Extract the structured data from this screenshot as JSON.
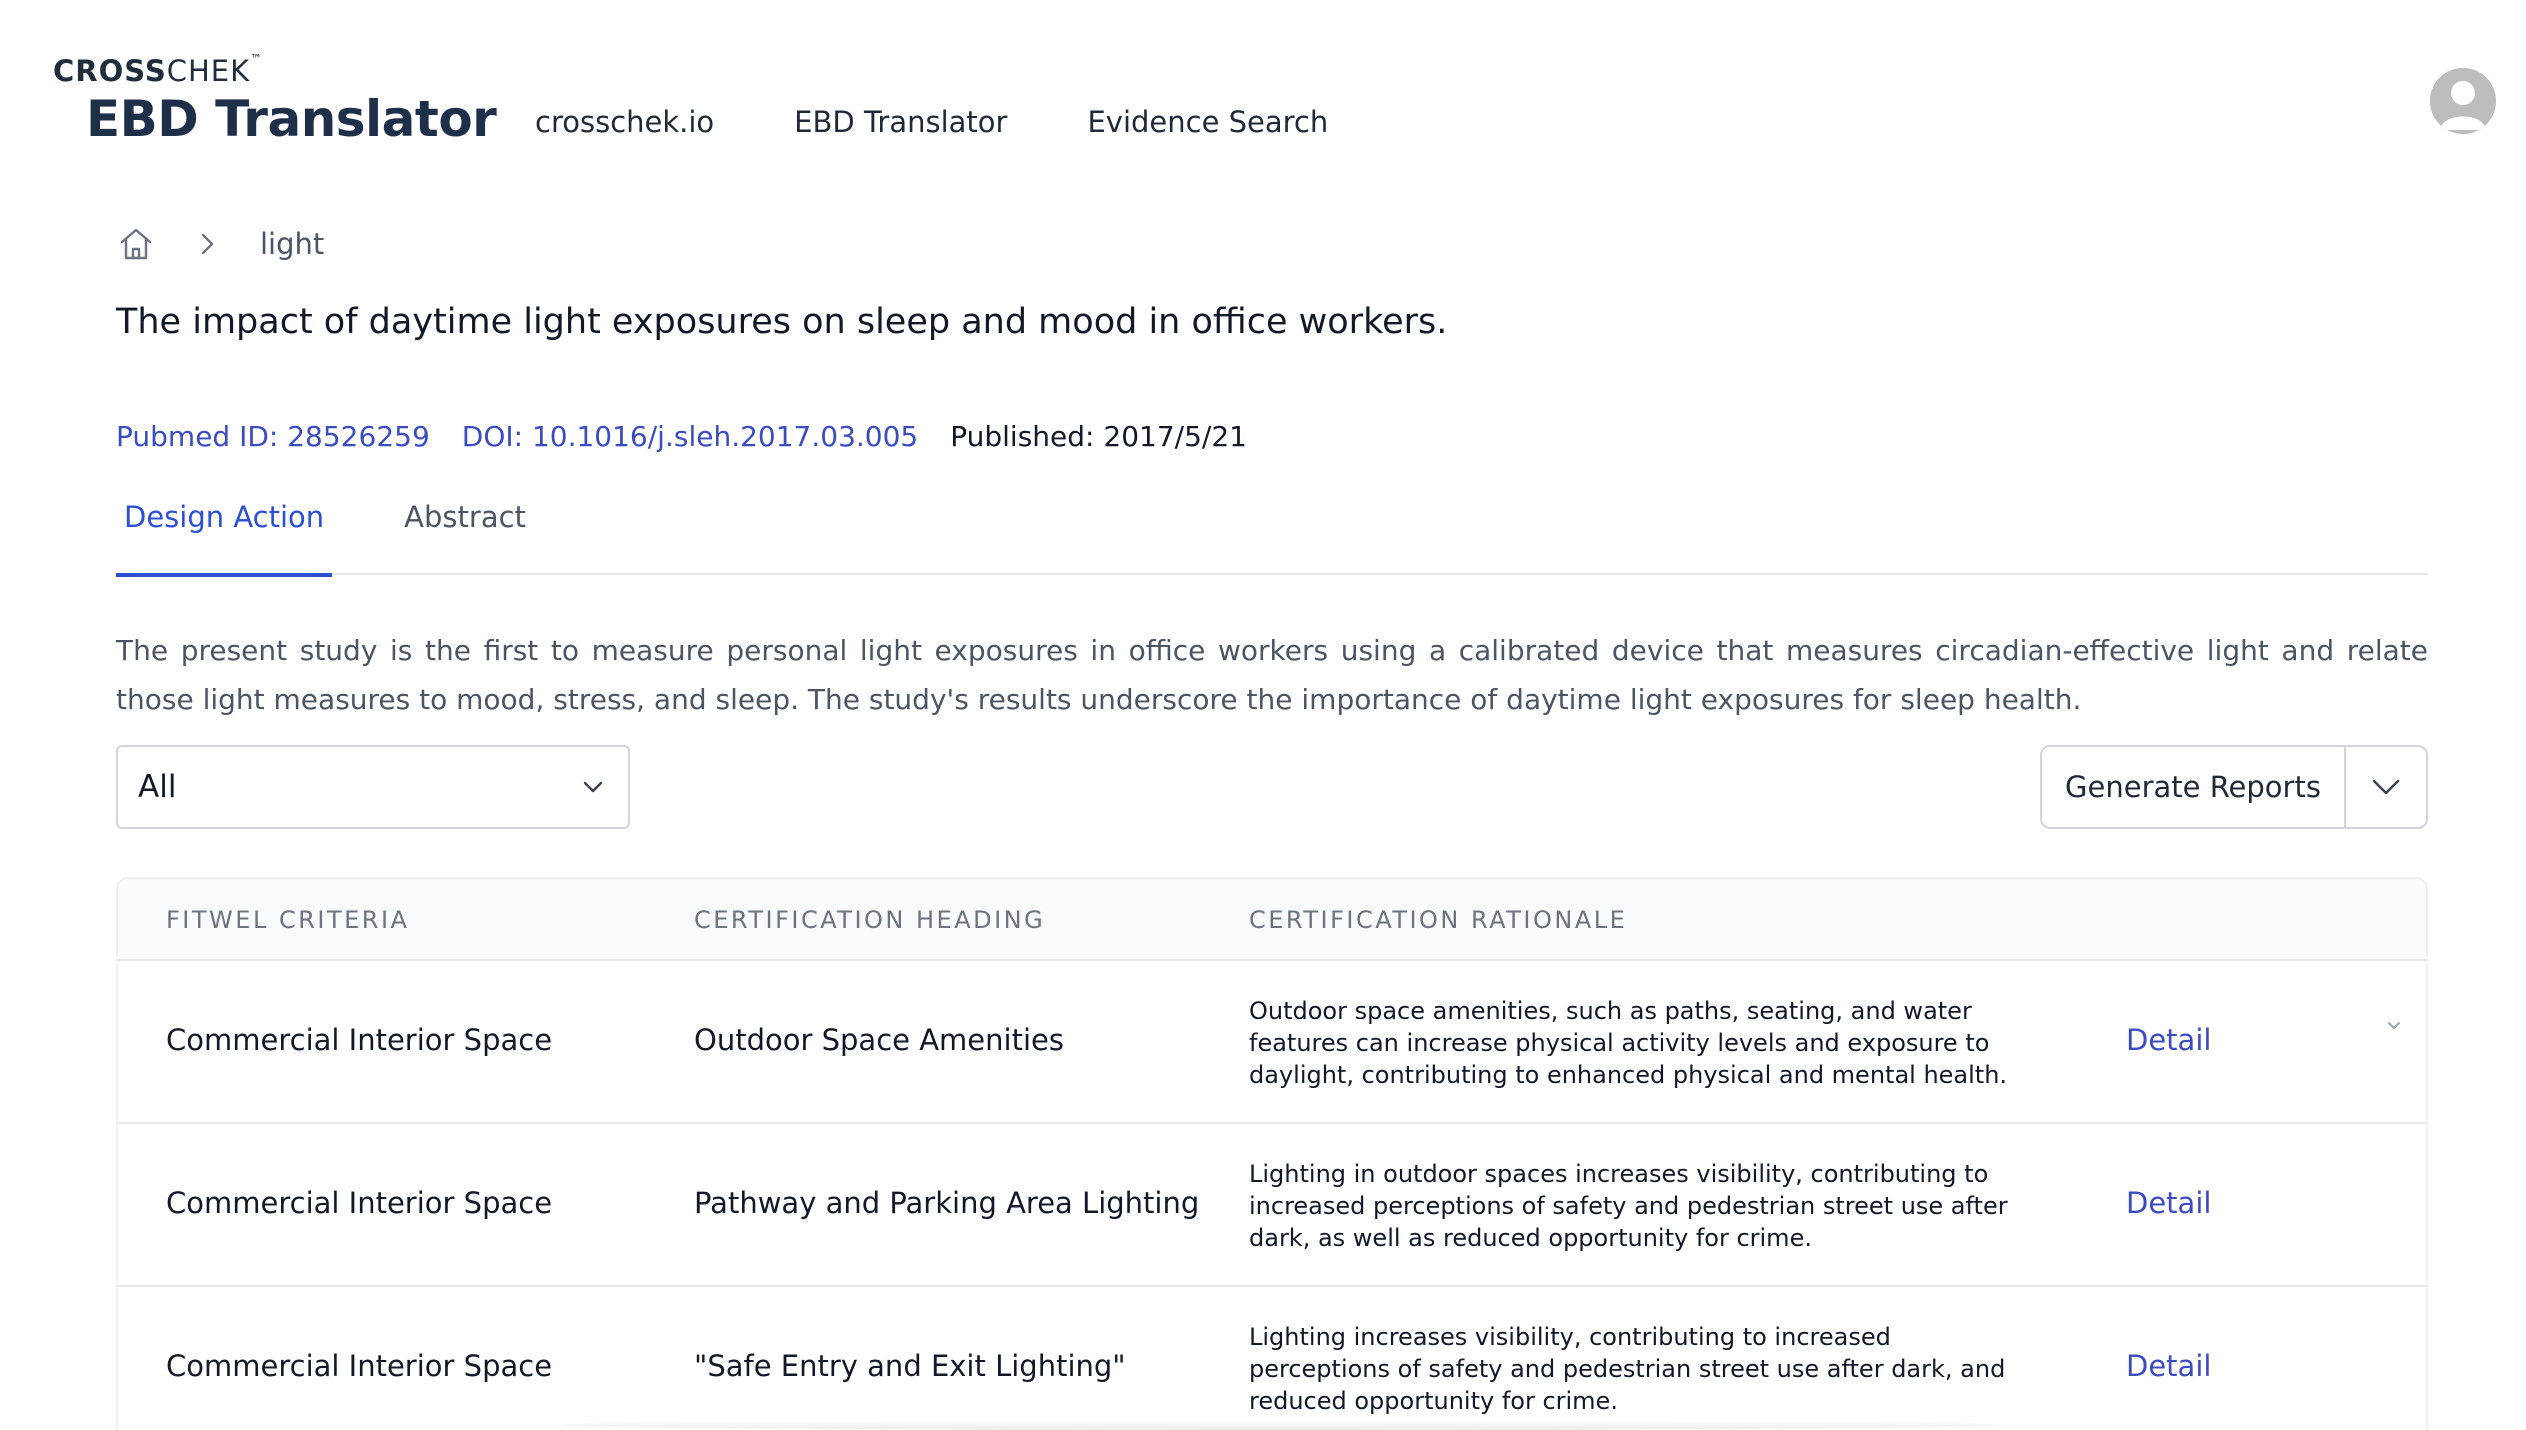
{
  "header": {
    "brand_small_bold": "CROSS",
    "brand_small_light": "CHEK",
    "brand_small_tm": "™",
    "app_title": "EBD Translator",
    "nav": [
      {
        "label": "crosschek.io"
      },
      {
        "label": "EBD Translator"
      },
      {
        "label": "Evidence Search"
      }
    ],
    "avatar_icon": "user-avatar-icon"
  },
  "breadcrumb": {
    "home_icon": "home-icon",
    "separator_icon": "chevron-right-icon",
    "current": "light"
  },
  "article": {
    "title": "The impact of daytime light exposures on sleep and mood in office workers.",
    "pubmed": "Pubmed ID: 28526259",
    "doi": "DOI: 10.1016/j.sleh.2017.03.005",
    "published": "Published: 2017/5/21"
  },
  "tabs": [
    {
      "label": "Design Action",
      "active": true
    },
    {
      "label": "Abstract",
      "active": false
    }
  ],
  "summary": "The present study is the first to measure personal light exposures in office workers using a calibrated device that measures circadian-effective light and relate those light measures to mood, stress, and sleep. The study's results underscore the importance of daytime light exposures for sleep health.",
  "filter": {
    "selected": "All"
  },
  "reports": {
    "label": "Generate Reports"
  },
  "table": {
    "headers": [
      "FITWEL CRITERIA",
      "CERTIFICATION HEADING",
      "CERTIFICATION RATIONALE"
    ],
    "rows": [
      {
        "criteria": "Commercial Interior Space",
        "heading": "Outdoor Space Amenities",
        "rationale": "Outdoor space amenities, such as paths, seating, and water features can increase physical activity levels and exposure to daylight, contributing to enhanced physical and mental health.",
        "action": "Detail"
      },
      {
        "criteria": "Commercial Interior Space",
        "heading": "Pathway and Parking Area Lighting",
        "rationale": "Lighting in outdoor spaces increases visibility, contributing to increased perceptions of safety and pedestrian street use after dark, as well as reduced opportunity for crime.",
        "action": "Detail"
      },
      {
        "criteria": "Commercial Interior Space",
        "heading": "\"Safe Entry and Exit Lighting\"",
        "rationale": "Lighting increases visibility, contributing to increased perceptions of safety and pedestrian street use after dark, and reduced opportunity for crime.",
        "action": "Detail"
      }
    ]
  },
  "colors": {
    "link": "#3b4cc0",
    "active_tab": "#2c4fd4",
    "brand": "#1e2f4a"
  }
}
